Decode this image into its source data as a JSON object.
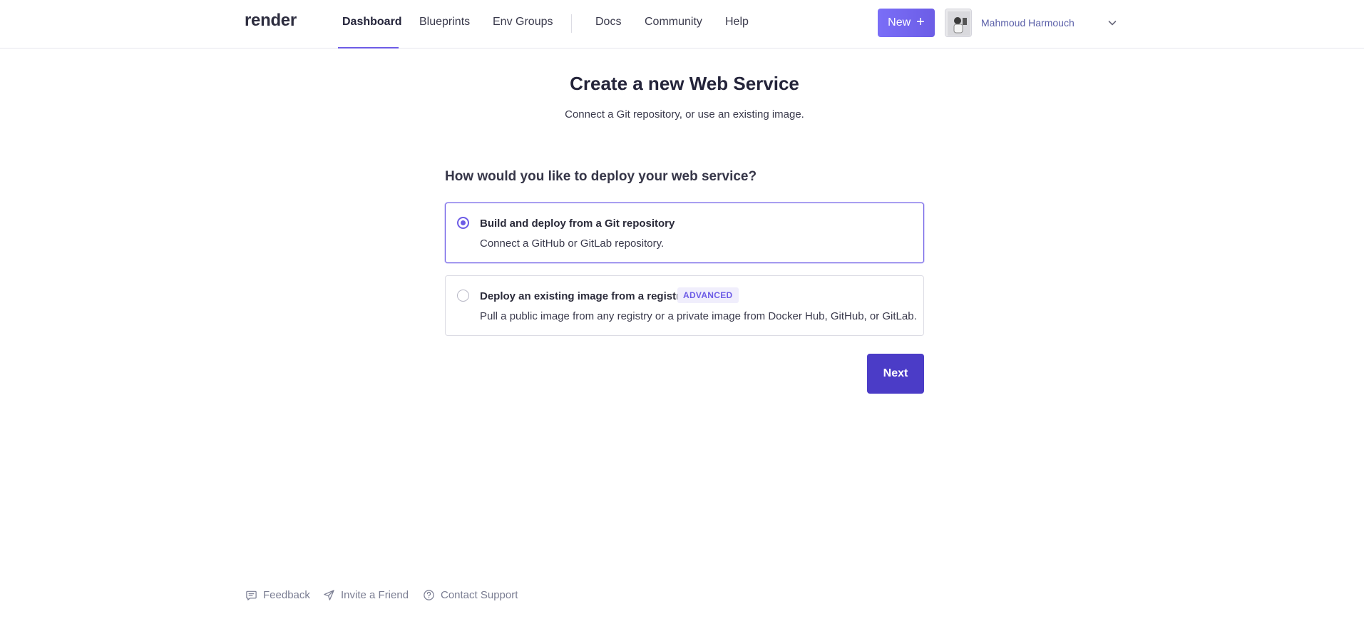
{
  "brand": {
    "logo": "render"
  },
  "nav": {
    "items": [
      {
        "label": "Dashboard",
        "active": true
      },
      {
        "label": "Blueprints"
      },
      {
        "label": "Env Groups"
      },
      {
        "label": "Docs"
      },
      {
        "label": "Community"
      },
      {
        "label": "Help"
      }
    ],
    "new_button": "New",
    "user_name": "Mahmoud Harmouch"
  },
  "main": {
    "title_prefix": "Create a new",
    "title_strong": "Web Service",
    "subtitle": "Connect a Git repository, or use an existing image.",
    "question": "How would you like to deploy your web service?",
    "options": [
      {
        "title": "Build and deploy from a Git repository",
        "description": "Connect a GitHub or GitLab repository.",
        "selected": true
      },
      {
        "title": "Deploy an existing image from a registry",
        "badge": "ADVANCED",
        "description": "Pull a public image from any registry or a private image from Docker Hub, GitHub, or GitLab.",
        "selected": false
      }
    ],
    "next_button": "Next"
  },
  "footer": {
    "links": [
      {
        "label": "Feedback",
        "icon": "chat-icon"
      },
      {
        "label": "Invite a Friend",
        "icon": "send-icon"
      },
      {
        "label": "Contact Support",
        "icon": "question-icon"
      }
    ]
  },
  "colors": {
    "accent": "#6d5ce6",
    "next_button": "#4b3cc7",
    "badge_bg": "#f0eefc"
  }
}
